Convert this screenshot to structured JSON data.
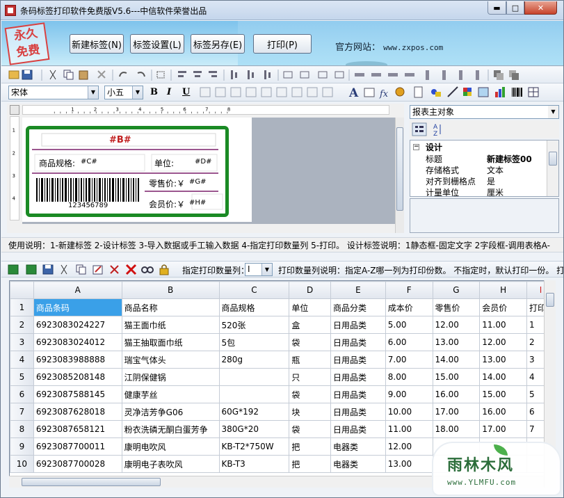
{
  "window": {
    "title": "条码标签打印软件免费版V5.6---中信软件荣誉出品"
  },
  "banner": {
    "stamp": "永久\n免费",
    "buttons": [
      "新建标签(N)",
      "标签设置(L)",
      "标签另存(E)",
      "打印(P)"
    ],
    "site_label": "官方网站：",
    "site_url": "www.zxpos.com"
  },
  "format_bar": {
    "font": "宋体",
    "size": "小五",
    "bold": "B",
    "italic": "I",
    "underline": "U"
  },
  "label": {
    "field_b": "#B#",
    "spec_label": "商品规格:",
    "field_c": "#C#",
    "unit_label": "单位:",
    "field_d": "#D#",
    "retail_label": "零售价:￥",
    "field_g": "#G#",
    "member_label": "会员价:￥",
    "field_h": "#H#",
    "barcode_number": "123456789"
  },
  "properties": {
    "object": "报表主对象",
    "section": "设计",
    "rows": [
      {
        "k": "标题",
        "v": "新建标签00",
        "bold": true
      },
      {
        "k": "存储格式",
        "v": "文本"
      },
      {
        "k": "对齐到栅格点",
        "v": "是"
      },
      {
        "k": "计量单位",
        "v": "厘米"
      }
    ]
  },
  "hint": "使用说明：1-新建标签 2-设计标签 3-导入数据或手工输入数据 4-指定打印数量列 5-打印。 设计标签说明：1静态框-固定文字 2字段框-调用表格A-",
  "data_toolbar": {
    "qty_label": "指定打印数量列：",
    "qty_value": "I",
    "qty_hint": "打印数量列说明：指定A-Z哪一列为打印份数。 不指定时，默认打印一份。 打"
  },
  "grid": {
    "columns": [
      "A",
      "B",
      "C",
      "D",
      "E",
      "F",
      "G",
      "H",
      "I"
    ],
    "rows": [
      [
        "1",
        "商品条码",
        "商品名称",
        "商品规格",
        "单位",
        "商品分类",
        "成本价",
        "零售价",
        "会员价",
        "打印"
      ],
      [
        "2",
        "6923083024227",
        "猫王面巾纸",
        "520张",
        "盒",
        "日用品类",
        "5.00",
        "12.00",
        "11.00",
        "1"
      ],
      [
        "3",
        "6923083024012",
        "猫王抽取面巾纸",
        "5包",
        "袋",
        "日用品类",
        "6.00",
        "13.00",
        "12.00",
        "2"
      ],
      [
        "4",
        "6923083988888",
        "瑞宝气体头",
        "280g",
        "瓶",
        "日用品类",
        "7.00",
        "14.00",
        "13.00",
        "3"
      ],
      [
        "5",
        "6923085208148",
        "江阴保健锅",
        "",
        "只",
        "日用品类",
        "8.00",
        "15.00",
        "14.00",
        "4"
      ],
      [
        "6",
        "6923087588145",
        "健康芋丝",
        "",
        "袋",
        "日用品类",
        "9.00",
        "16.00",
        "15.00",
        "5"
      ],
      [
        "7",
        "6923087628018",
        "灵净洁芳争G06",
        "60G*192",
        "块",
        "日用品类",
        "10.00",
        "17.00",
        "16.00",
        "6"
      ],
      [
        "8",
        "6923087658121",
        "粉衣洗磷无酮白蛋芳争",
        "380G*20",
        "袋",
        "日用品类",
        "11.00",
        "18.00",
        "17.00",
        "7"
      ],
      [
        "9",
        "6923087700011",
        "康明电吹风",
        "KB-T2*750W",
        "把",
        "电器类",
        "12.00",
        "",
        "",
        ""
      ],
      [
        "10",
        "6923087700028",
        "康明电子表吹风",
        "KB-T3",
        "把",
        "电器类",
        "13.00",
        "",
        "",
        ""
      ]
    ]
  },
  "watermark": {
    "title": "雨林木风",
    "url": "www.YLMFU.com"
  }
}
